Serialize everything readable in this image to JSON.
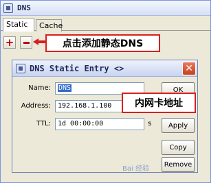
{
  "window": {
    "title": "DNS"
  },
  "tabs": [
    {
      "label": "Static"
    },
    {
      "label": "Cache"
    }
  ],
  "toolbar": {
    "add_icon": "+"
  },
  "callouts": {
    "add_hint": "点击添加静态DNS",
    "address_hint": "内网卡地址"
  },
  "dialog": {
    "title": "DNS Static Entry <>",
    "close_icon": "✕",
    "name_label": "Name:",
    "name_value": "DNS",
    "address_label": "Address:",
    "address_value": "192.168.1.100",
    "ttl_label": "TTL:",
    "ttl_value": "1d 00:00:00",
    "ttl_unit": "s",
    "buttons": {
      "ok": "OK",
      "apply": "Apply",
      "copy": "Copy",
      "remove": "Remove"
    }
  },
  "watermark": "Bai 经验",
  "colors": {
    "callout_border": "#d81e1e",
    "add_icon": "#c00000",
    "title_bar": "#c8d4f2"
  }
}
